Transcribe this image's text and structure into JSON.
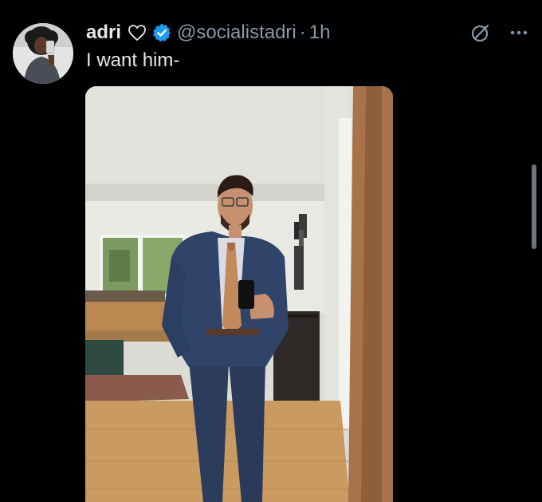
{
  "tweet": {
    "display_name": "adri",
    "handle": "@socialistadri",
    "separator": "·",
    "time": "1h",
    "text": "I want him-"
  },
  "icons": {
    "heart": "heart-outline-icon",
    "verified": "verified-badge-icon",
    "grok": "grok-icon",
    "more": "more-horizontal-icon"
  },
  "colors": {
    "background": "#000000",
    "text": "#e7e9ea",
    "secondary_text": "#8b98a5",
    "verified": "#1d9bf0"
  }
}
